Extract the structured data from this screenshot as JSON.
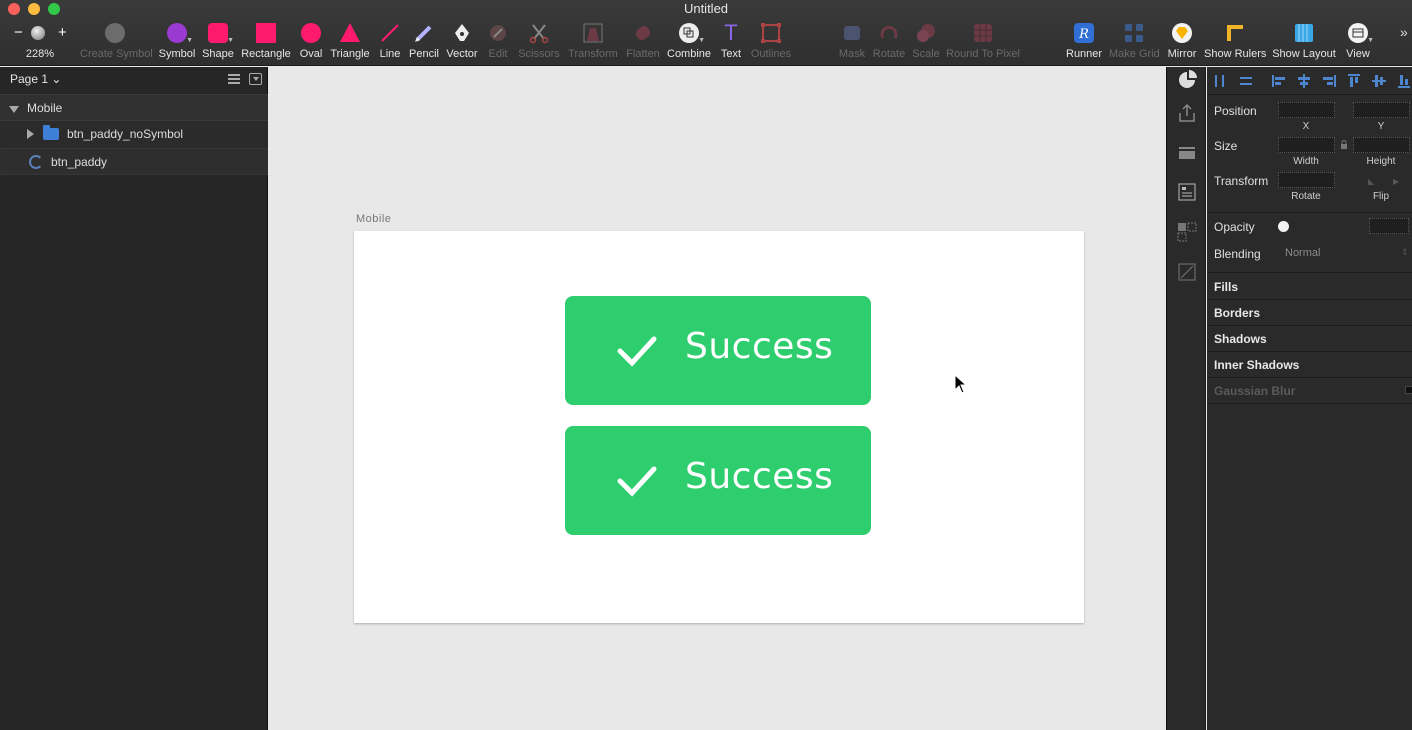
{
  "window": {
    "title": "Untitled"
  },
  "zoom": {
    "level": "228%",
    "minus": "−",
    "plus": "+"
  },
  "toolbar": {
    "create_symbol": "Create Symbol",
    "symbol": "Symbol",
    "shape": "Shape",
    "rectangle": "Rectangle",
    "oval": "Oval",
    "triangle": "Triangle",
    "line": "Line",
    "pencil": "Pencil",
    "vector": "Vector",
    "edit": "Edit",
    "scissors": "Scissors",
    "transform": "Transform",
    "flatten": "Flatten",
    "combine": "Combine",
    "text": "Text",
    "outlines": "Outlines",
    "mask": "Mask",
    "rotate": "Rotate",
    "scale": "Scale",
    "round_to_pixel": "Round To Pixel",
    "runner": "Runner",
    "make_grid": "Make Grid",
    "mirror": "Mirror",
    "show_rulers": "Show Rulers",
    "show_layout": "Show Layout",
    "view": "View",
    "overflow": "»"
  },
  "layers_panel": {
    "page": "Page 1",
    "page_chevron": "⌄",
    "layers": [
      {
        "name": "Mobile",
        "type": "artboard"
      },
      {
        "name": "btn_paddy_noSymbol",
        "type": "group"
      },
      {
        "name": "btn_paddy",
        "type": "symbol"
      }
    ]
  },
  "canvas": {
    "artboard_label": "Mobile",
    "buttons": [
      {
        "label": "Success"
      },
      {
        "label": "Success"
      }
    ]
  },
  "inspector": {
    "position": "Position",
    "x": "X",
    "y": "Y",
    "size": "Size",
    "width": "Width",
    "height": "Height",
    "transform": "Transform",
    "rotate": "Rotate",
    "flip": "Flip",
    "opacity": "Opacity",
    "blending": "Blending",
    "blending_value": "Normal",
    "fills": "Fills",
    "borders": "Borders",
    "shadows": "Shadows",
    "inner_shadows": "Inner Shadows",
    "gaussian_blur": "Gaussian Blur"
  },
  "colors": {
    "success_green": "#2ecd6d",
    "tool_pink": "#ff1a6e",
    "accent_blue": "#4d86cf"
  }
}
